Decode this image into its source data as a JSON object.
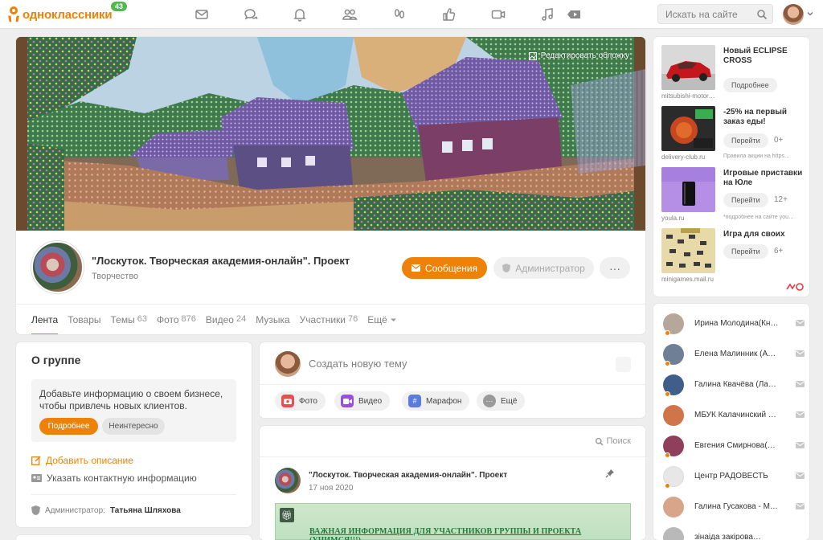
{
  "topbar": {
    "logo_text": "одноклассники",
    "badge": "43",
    "search_placeholder": "Искать на сайте"
  },
  "nav_icons": [
    "messages-icon",
    "discussions-icon",
    "notifications-icon",
    "friends-icon",
    "guests-icon",
    "events-icon",
    "video-icon",
    "music-icon",
    "games-icon"
  ],
  "group": {
    "edit_cover": "Редактировать обложку",
    "title": "\"Лоскуток. Творческая академия-онлайн\". Проект",
    "category": "Творчество",
    "messages_btn": "Сообщения",
    "admin_btn": "Администратор",
    "more_btn": "···"
  },
  "tabs": [
    {
      "label": "Лента",
      "count": ""
    },
    {
      "label": "Товары",
      "count": ""
    },
    {
      "label": "Темы",
      "count": "63"
    },
    {
      "label": "Фото",
      "count": "876"
    },
    {
      "label": "Видео",
      "count": "24"
    },
    {
      "label": "Музыка",
      "count": ""
    },
    {
      "label": "Участники",
      "count": "76"
    },
    {
      "label": "Ещё",
      "count": ""
    }
  ],
  "about": {
    "title": "О группе",
    "promo_text": "Добавьте информацию о своем бизнесе, чтобы привлечь новых клиентов.",
    "more_btn": "Подробнее",
    "not_interesting_btn": "Неинтересно",
    "add_description": "Добавить описание",
    "add_contacts": "Указать контактную информацию",
    "admin_label": "Администратор:",
    "admin_name": "Татьяна Шляхова"
  },
  "create": {
    "placeholder": "Создать новую тему",
    "chips": [
      {
        "label": "Фото",
        "icon": "camera-icon",
        "color": "#e94f4f"
      },
      {
        "label": "Видео",
        "icon": "video-camera-icon",
        "color": "#9b4de0"
      },
      {
        "label": "Марафон",
        "icon": "hashtag-icon",
        "color": "#5b7be3"
      },
      {
        "label": "Ещё",
        "icon": "more-icon",
        "color": "#9a9a9a"
      }
    ]
  },
  "feed": {
    "search_label": "Поиск",
    "post_author": "\"Лоскуток. Творческая академия-онлайн\". Проект",
    "post_date": "17 ноя 2020",
    "post_headline": "ВАЖНАЯ ИНФОРМАЦИЯ ДЛЯ УЧАСТНИКОВ ГРУППЫ И ПРОЕКТА (УЧИМСЯ!!!)"
  },
  "ads": [
    {
      "title": "Новый ECLIPSE CROSS",
      "button": "Подробнее",
      "domain": "mitsubishi-motor…",
      "age": "",
      "note": ""
    },
    {
      "title": "-25% на первый заказ еды!",
      "button": "Перейти",
      "domain": "delivery-club.ru",
      "age": "0+",
      "note": "Правила акции на https…"
    },
    {
      "title": "Игровые приставки на Юле",
      "button": "Перейти",
      "domain": "youla.ru",
      "age": "12+",
      "note": "*подробнее на сайте you…"
    },
    {
      "title": "Игра для своих",
      "button": "Перейти",
      "domain": "minigames.mail.ru",
      "age": "6+",
      "note": ""
    }
  ],
  "members": [
    {
      "name": "Ирина Молодина(Кн…",
      "dot": "#ee8208",
      "ava": "#b6a79a"
    },
    {
      "name": "Елена Малинник (А…",
      "dot": "#ee8208",
      "ava": "#6f7f96"
    },
    {
      "name": "Галина Квачёва (Ла…",
      "dot": "#ee8208",
      "ava": "#3f5e8a"
    },
    {
      "name": "МБУК Калачинский …",
      "dot": "",
      "ava": "#d0754a"
    },
    {
      "name": "Евгения Смирнова(…",
      "dot": "#ee8208",
      "ava": "#8f3f5b"
    },
    {
      "name": "Центр РАДОВЕСТЬ",
      "dot": "#ee8208",
      "ava": "#e7e7e7"
    },
    {
      "name": "Галина Гусакова - М…",
      "dot": "",
      "ava": "#d9a58a"
    },
    {
      "name": "зінаіда закірова…",
      "dot": "",
      "ava": "#b9b9b9"
    }
  ],
  "colors": {
    "accent": "#ee8208",
    "online_green": "#51b851"
  }
}
